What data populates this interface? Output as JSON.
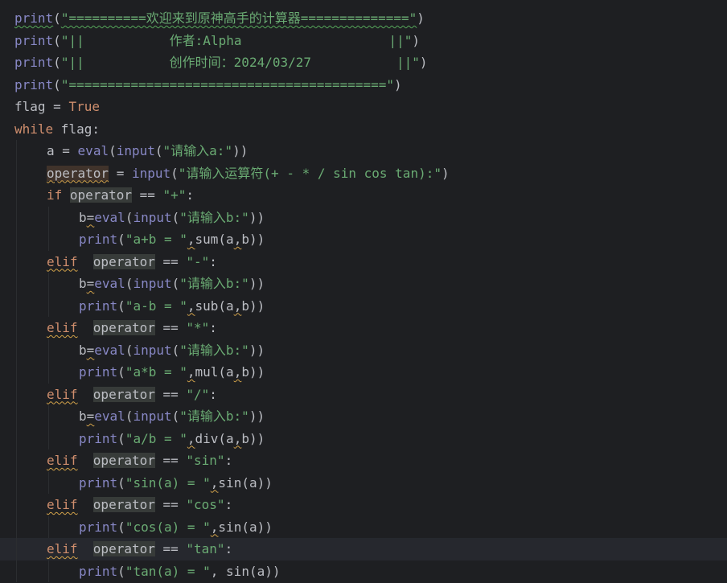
{
  "editor": {
    "language": "python",
    "current_line_index": 24,
    "lines": [
      {
        "indent": 0,
        "tokens": [
          {
            "t": "print",
            "c": "tok-builtin",
            "m": "typo"
          },
          {
            "t": "(",
            "c": "tok-plain"
          },
          {
            "t": "\"==========欢迎来到原神高手的计算器==============\"",
            "c": "tok-str",
            "m": "typo"
          },
          {
            "t": ")",
            "c": "tok-plain"
          }
        ]
      },
      {
        "indent": 0,
        "tokens": [
          {
            "t": "print",
            "c": "tok-builtin"
          },
          {
            "t": "(",
            "c": "tok-plain"
          },
          {
            "t": "\"||           作者:Alpha                   ||\"",
            "c": "tok-str"
          },
          {
            "t": ")",
            "c": "tok-plain"
          }
        ]
      },
      {
        "indent": 0,
        "tokens": [
          {
            "t": "print",
            "c": "tok-builtin"
          },
          {
            "t": "(",
            "c": "tok-plain"
          },
          {
            "t": "\"||           创作时间：2024/03/27           ||\"",
            "c": "tok-str"
          },
          {
            "t": ")",
            "c": "tok-plain"
          }
        ]
      },
      {
        "indent": 0,
        "tokens": [
          {
            "t": "print",
            "c": "tok-builtin"
          },
          {
            "t": "(",
            "c": "tok-plain"
          },
          {
            "t": "\"=========================================\"",
            "c": "tok-str"
          },
          {
            "t": ")",
            "c": "tok-plain"
          }
        ]
      },
      {
        "indent": 0,
        "tokens": [
          {
            "t": "flag",
            "c": "tok-var"
          },
          {
            "t": " = ",
            "c": "tok-plain"
          },
          {
            "t": "True",
            "c": "tok-kw"
          }
        ]
      },
      {
        "indent": 0,
        "tokens": [
          {
            "t": "while",
            "c": "tok-kw"
          },
          {
            "t": " flag:",
            "c": "tok-plain"
          }
        ]
      },
      {
        "indent": 1,
        "tokens": [
          {
            "t": "a",
            "c": "tok-var"
          },
          {
            "t": " = ",
            "c": "tok-plain"
          },
          {
            "t": "eval",
            "c": "tok-builtin"
          },
          {
            "t": "(",
            "c": "tok-plain"
          },
          {
            "t": "input",
            "c": "tok-builtin"
          },
          {
            "t": "(",
            "c": "tok-plain"
          },
          {
            "t": "\"请输入a:\"",
            "c": "tok-str"
          },
          {
            "t": "))",
            "c": "tok-plain"
          }
        ]
      },
      {
        "indent": 1,
        "tokens": [
          {
            "t": "operator",
            "c": "tok-var",
            "m": "hl-write warn"
          },
          {
            "t": " = ",
            "c": "tok-plain"
          },
          {
            "t": "input",
            "c": "tok-builtin"
          },
          {
            "t": "(",
            "c": "tok-plain"
          },
          {
            "t": "\"请输入运算符(+ - * / sin cos tan):\"",
            "c": "tok-str"
          },
          {
            "t": ")",
            "c": "tok-plain"
          }
        ]
      },
      {
        "indent": 1,
        "tokens": [
          {
            "t": "if",
            "c": "tok-kw"
          },
          {
            "t": " ",
            "c": "tok-plain"
          },
          {
            "t": "operator",
            "c": "tok-var",
            "m": "hl-ref"
          },
          {
            "t": " == ",
            "c": "tok-plain"
          },
          {
            "t": "\"+\"",
            "c": "tok-str"
          },
          {
            "t": ":",
            "c": "tok-plain"
          }
        ]
      },
      {
        "indent": 2,
        "tokens": [
          {
            "t": "b",
            "c": "tok-var"
          },
          {
            "t": "=",
            "c": "tok-plain",
            "m": "warn"
          },
          {
            "t": "eval",
            "c": "tok-builtin"
          },
          {
            "t": "(",
            "c": "tok-plain"
          },
          {
            "t": "input",
            "c": "tok-builtin"
          },
          {
            "t": "(",
            "c": "tok-plain"
          },
          {
            "t": "\"请输入b:\"",
            "c": "tok-str"
          },
          {
            "t": "))",
            "c": "tok-plain"
          }
        ]
      },
      {
        "indent": 2,
        "tokens": [
          {
            "t": "print",
            "c": "tok-builtin"
          },
          {
            "t": "(",
            "c": "tok-plain"
          },
          {
            "t": "\"a+b = \"",
            "c": "tok-str"
          },
          {
            "t": ",",
            "c": "tok-plain",
            "m": "warn"
          },
          {
            "t": "sum(a",
            "c": "tok-plain"
          },
          {
            "t": ",",
            "c": "tok-plain",
            "m": "warn"
          },
          {
            "t": "b))",
            "c": "tok-plain"
          }
        ]
      },
      {
        "indent": 1,
        "tokens": [
          {
            "t": "elif",
            "c": "tok-kw",
            "m": "warn"
          },
          {
            "t": "  ",
            "c": "tok-plain"
          },
          {
            "t": "operator",
            "c": "tok-var",
            "m": "hl-ref"
          },
          {
            "t": " == ",
            "c": "tok-plain"
          },
          {
            "t": "\"-\"",
            "c": "tok-str"
          },
          {
            "t": ":",
            "c": "tok-plain"
          }
        ]
      },
      {
        "indent": 2,
        "tokens": [
          {
            "t": "b",
            "c": "tok-var"
          },
          {
            "t": "=",
            "c": "tok-plain",
            "m": "warn"
          },
          {
            "t": "eval",
            "c": "tok-builtin"
          },
          {
            "t": "(",
            "c": "tok-plain"
          },
          {
            "t": "input",
            "c": "tok-builtin"
          },
          {
            "t": "(",
            "c": "tok-plain"
          },
          {
            "t": "\"请输入b:\"",
            "c": "tok-str"
          },
          {
            "t": "))",
            "c": "tok-plain"
          }
        ]
      },
      {
        "indent": 2,
        "tokens": [
          {
            "t": "print",
            "c": "tok-builtin"
          },
          {
            "t": "(",
            "c": "tok-plain"
          },
          {
            "t": "\"a-b = \"",
            "c": "tok-str"
          },
          {
            "t": ",",
            "c": "tok-plain",
            "m": "warn"
          },
          {
            "t": "sub(a",
            "c": "tok-plain"
          },
          {
            "t": ",",
            "c": "tok-plain",
            "m": "warn"
          },
          {
            "t": "b))",
            "c": "tok-plain"
          }
        ]
      },
      {
        "indent": 1,
        "tokens": [
          {
            "t": "elif",
            "c": "tok-kw",
            "m": "warn"
          },
          {
            "t": "  ",
            "c": "tok-plain"
          },
          {
            "t": "operator",
            "c": "tok-var",
            "m": "hl-ref"
          },
          {
            "t": " == ",
            "c": "tok-plain"
          },
          {
            "t": "\"*\"",
            "c": "tok-str"
          },
          {
            "t": ":",
            "c": "tok-plain"
          }
        ]
      },
      {
        "indent": 2,
        "tokens": [
          {
            "t": "b",
            "c": "tok-var"
          },
          {
            "t": "=",
            "c": "tok-plain",
            "m": "warn"
          },
          {
            "t": "eval",
            "c": "tok-builtin"
          },
          {
            "t": "(",
            "c": "tok-plain"
          },
          {
            "t": "input",
            "c": "tok-builtin"
          },
          {
            "t": "(",
            "c": "tok-plain"
          },
          {
            "t": "\"请输入b:\"",
            "c": "tok-str"
          },
          {
            "t": "))",
            "c": "tok-plain"
          }
        ]
      },
      {
        "indent": 2,
        "tokens": [
          {
            "t": "print",
            "c": "tok-builtin"
          },
          {
            "t": "(",
            "c": "tok-plain"
          },
          {
            "t": "\"a*b = \"",
            "c": "tok-str"
          },
          {
            "t": ",",
            "c": "tok-plain",
            "m": "warn"
          },
          {
            "t": "mul(a",
            "c": "tok-plain"
          },
          {
            "t": ",",
            "c": "tok-plain",
            "m": "warn"
          },
          {
            "t": "b))",
            "c": "tok-plain"
          }
        ]
      },
      {
        "indent": 1,
        "tokens": [
          {
            "t": "elif",
            "c": "tok-kw",
            "m": "warn"
          },
          {
            "t": "  ",
            "c": "tok-plain"
          },
          {
            "t": "operator",
            "c": "tok-var",
            "m": "hl-ref"
          },
          {
            "t": " == ",
            "c": "tok-plain"
          },
          {
            "t": "\"/\"",
            "c": "tok-str"
          },
          {
            "t": ":",
            "c": "tok-plain"
          }
        ]
      },
      {
        "indent": 2,
        "tokens": [
          {
            "t": "b",
            "c": "tok-var"
          },
          {
            "t": "=",
            "c": "tok-plain",
            "m": "warn"
          },
          {
            "t": "eval",
            "c": "tok-builtin"
          },
          {
            "t": "(",
            "c": "tok-plain"
          },
          {
            "t": "input",
            "c": "tok-builtin"
          },
          {
            "t": "(",
            "c": "tok-plain"
          },
          {
            "t": "\"请输入b:\"",
            "c": "tok-str"
          },
          {
            "t": "))",
            "c": "tok-plain"
          }
        ]
      },
      {
        "indent": 2,
        "tokens": [
          {
            "t": "print",
            "c": "tok-builtin"
          },
          {
            "t": "(",
            "c": "tok-plain"
          },
          {
            "t": "\"a/b = \"",
            "c": "tok-str"
          },
          {
            "t": ",",
            "c": "tok-plain",
            "m": "warn"
          },
          {
            "t": "div(a",
            "c": "tok-plain"
          },
          {
            "t": ",",
            "c": "tok-plain",
            "m": "warn"
          },
          {
            "t": "b))",
            "c": "tok-plain"
          }
        ]
      },
      {
        "indent": 1,
        "tokens": [
          {
            "t": "elif",
            "c": "tok-kw",
            "m": "warn"
          },
          {
            "t": "  ",
            "c": "tok-plain"
          },
          {
            "t": "operator",
            "c": "tok-var",
            "m": "hl-ref"
          },
          {
            "t": " == ",
            "c": "tok-plain"
          },
          {
            "t": "\"sin\"",
            "c": "tok-str"
          },
          {
            "t": ":",
            "c": "tok-plain"
          }
        ]
      },
      {
        "indent": 2,
        "tokens": [
          {
            "t": "print",
            "c": "tok-builtin"
          },
          {
            "t": "(",
            "c": "tok-plain"
          },
          {
            "t": "\"sin(a) = \"",
            "c": "tok-str"
          },
          {
            "t": ",",
            "c": "tok-plain",
            "m": "warn"
          },
          {
            "t": "sin(a))",
            "c": "tok-plain"
          }
        ]
      },
      {
        "indent": 1,
        "tokens": [
          {
            "t": "elif",
            "c": "tok-kw",
            "m": "warn"
          },
          {
            "t": "  ",
            "c": "tok-plain"
          },
          {
            "t": "operator",
            "c": "tok-var",
            "m": "hl-ref"
          },
          {
            "t": " == ",
            "c": "tok-plain"
          },
          {
            "t": "\"cos\"",
            "c": "tok-str"
          },
          {
            "t": ":",
            "c": "tok-plain"
          }
        ]
      },
      {
        "indent": 2,
        "tokens": [
          {
            "t": "print",
            "c": "tok-builtin"
          },
          {
            "t": "(",
            "c": "tok-plain"
          },
          {
            "t": "\"cos(a) = \"",
            "c": "tok-str"
          },
          {
            "t": ",",
            "c": "tok-plain",
            "m": "warn"
          },
          {
            "t": "sin(a))",
            "c": "tok-plain"
          }
        ]
      },
      {
        "indent": 1,
        "tokens": [
          {
            "t": "elif",
            "c": "tok-kw",
            "m": "warn"
          },
          {
            "t": "  ",
            "c": "tok-plain"
          },
          {
            "t": "operator",
            "c": "tok-var",
            "m": "hl-ref"
          },
          {
            "t": " == ",
            "c": "tok-plain"
          },
          {
            "t": "\"tan\"",
            "c": "tok-str"
          },
          {
            "t": ":",
            "c": "tok-plain"
          }
        ]
      },
      {
        "indent": 2,
        "tokens": [
          {
            "t": "print",
            "c": "tok-builtin"
          },
          {
            "t": "(",
            "c": "tok-plain"
          },
          {
            "t": "\"tan(a) = \"",
            "c": "tok-str"
          },
          {
            "t": ", ",
            "c": "tok-plain"
          },
          {
            "t": "sin(a))",
            "c": "tok-plain"
          }
        ]
      }
    ]
  },
  "colors": {
    "background": "#1e1f22",
    "current_line": "#26282e",
    "keyword": "#cf8e6d",
    "builtin": "#8888c6",
    "string": "#6aab73",
    "text": "#bcbec4"
  }
}
